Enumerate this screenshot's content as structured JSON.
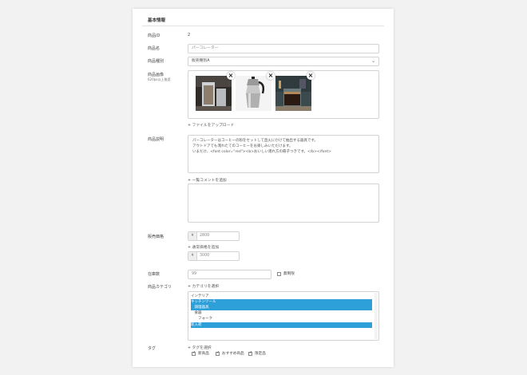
{
  "section": {
    "title": "基本情報"
  },
  "product_id": {
    "label": "商品ID",
    "value": "2"
  },
  "product_name": {
    "label": "商品名",
    "value": "パーコレーター"
  },
  "product_type": {
    "label": "商品種別",
    "value": "販売種別A"
  },
  "product_image": {
    "label": "商品画像",
    "sub": "620px以上推奨",
    "upload_label": "ファイルをアップロード"
  },
  "description": {
    "label": "商品説明",
    "lines": [
      "パーコレーターはコーヒーの粉をセットして直火にかけて抽出する器具です。",
      "アウトドアでも淹れたてのコーヒーをお楽しみいただけます。",
      "いまだけ、<font color=\"red\"><b>おいしい淹れ方の冊子つきです。</b></font>"
    ]
  },
  "list_comment": {
    "add_label": "一覧コメントを追加",
    "value": ""
  },
  "price": {
    "label": "販売価格",
    "currency": "¥",
    "value": "2800",
    "normal_add_label": "通常価格を追加",
    "normal_value": "3000"
  },
  "stock": {
    "label": "在庫数",
    "value": "99",
    "unlimited_label": "無制限"
  },
  "category": {
    "label": "商品カテゴリ",
    "select_label": "カテゴリを選択",
    "options": [
      {
        "label": "インテリア",
        "selected": false
      },
      {
        "label": "キッチンツール",
        "selected": true
      },
      {
        "label": "　調理器具",
        "selected": true
      },
      {
        "label": "　食器",
        "selected": false
      },
      {
        "label": "　　フォーク",
        "selected": false
      },
      {
        "label": "新入荷",
        "selected": true
      }
    ]
  },
  "tags": {
    "label": "タグ",
    "select_label": "タグを選択",
    "items": [
      {
        "label": "新商品",
        "checked": true
      },
      {
        "label": "おすすめ商品",
        "checked": true
      },
      {
        "label": "限定品",
        "checked": true
      }
    ]
  },
  "icons": {
    "plus": "plus-icon",
    "close": "close-icon",
    "chevron": "chevron-down-icon",
    "check": "check-icon"
  }
}
